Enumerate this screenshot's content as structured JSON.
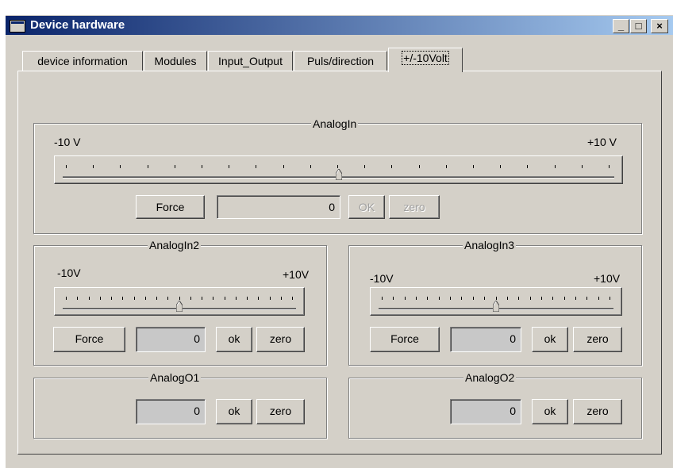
{
  "window": {
    "title": "Device hardware",
    "min_label": "_",
    "max_label": "□",
    "close_label": "×"
  },
  "tabs": [
    {
      "label": "device information"
    },
    {
      "label": "Modules"
    },
    {
      "label": "Input_Output"
    },
    {
      "label": "Puls/direction"
    },
    {
      "label": "+/-10Volt",
      "active": true
    }
  ],
  "analog_in": {
    "title": "AnalogIn",
    "min_label": "-10 V",
    "max_label": "+10 V",
    "force_label": "Force",
    "value": "0",
    "ok_label": "OK",
    "zero_label": "zero",
    "slider_position": 0.5
  },
  "analog_in2": {
    "title": "AnalogIn2",
    "min_label": "-10V",
    "max_label": "+10V",
    "force_label": "Force",
    "value": "0",
    "ok_label": "ok",
    "zero_label": "zero",
    "slider_position": 0.5
  },
  "analog_in3": {
    "title": "AnalogIn3",
    "min_label": "-10V",
    "max_label": "+10V",
    "force_label": "Force",
    "value": "0",
    "ok_label": "ok",
    "zero_label": "zero",
    "slider_position": 0.5
  },
  "analog_o1": {
    "title": "AnalogO1",
    "value": "0",
    "ok_label": "ok",
    "zero_label": "zero"
  },
  "analog_o2": {
    "title": "AnalogO2",
    "value": "0",
    "ok_label": "ok",
    "zero_label": "zero"
  },
  "colors": {
    "titlebar_start": "#0a246a",
    "titlebar_end": "#a6caf0",
    "face": "#d4d0c8"
  },
  "icons": {
    "window_icon": "window-icon",
    "slider_thumb": "slider-thumb-icon"
  }
}
